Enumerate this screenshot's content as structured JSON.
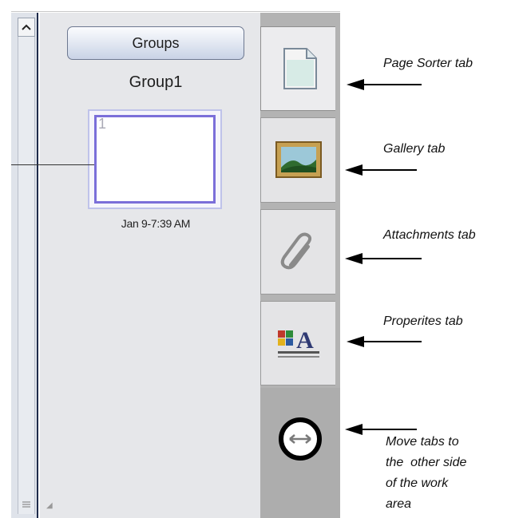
{
  "panel": {
    "groups_button": "Groups",
    "group_name": "Group1",
    "thumbnail": {
      "page_number": "1",
      "date_label": "Jan 9-7:39 AM"
    }
  },
  "tabs": [
    {
      "key": "page-sorter",
      "icon": "page-icon"
    },
    {
      "key": "gallery",
      "icon": "picture-icon"
    },
    {
      "key": "attachments",
      "icon": "paperclip-icon"
    },
    {
      "key": "properties",
      "icon": "properties-icon"
    },
    {
      "key": "move-tabs",
      "icon": "double-arrow-circle-icon"
    }
  ],
  "annotations": {
    "page_sorter": "Page Sorter tab",
    "gallery": "Gallery tab",
    "attachments": "Attachments tab",
    "properties": "Properites tab",
    "move_tabs": [
      "Move tabs to",
      "the  other side",
      "of the work",
      "area"
    ]
  },
  "colors": {
    "accent_border": "#7b6fd9",
    "arrow": "#000000"
  }
}
